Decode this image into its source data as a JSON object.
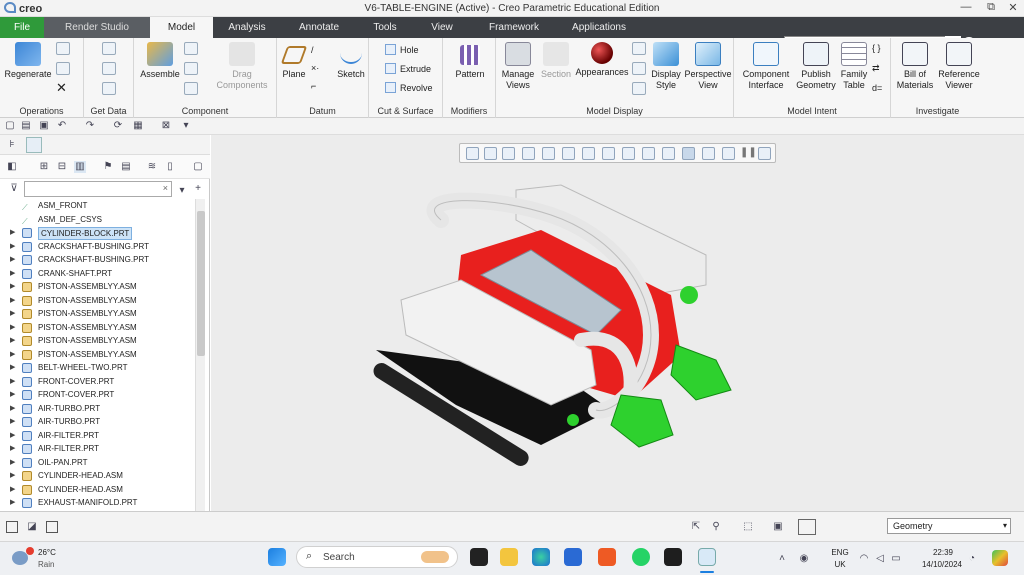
{
  "window": {
    "logo": "creo",
    "title": "V6-TABLE-ENGINE (Active) - Creo Parametric Educational Edition",
    "controls": [
      "—",
      "⧉",
      "✕"
    ]
  },
  "tabs": [
    "File",
    "Render Studio",
    "Model",
    "Analysis",
    "Annotate",
    "Tools",
    "View",
    "Framework",
    "Applications"
  ],
  "active_tab": "Model",
  "ribbon": {
    "operations": {
      "label": "Operations",
      "regenerate": "Regenerate"
    },
    "getdata": {
      "label": "Get Data"
    },
    "component": {
      "label": "Component",
      "assemble": "Assemble",
      "drag1": "Drag",
      "drag2": "Components"
    },
    "datum": {
      "label": "Datum",
      "plane": "Plane",
      "sketch": "Sketch"
    },
    "cutsurface": {
      "label": "Cut & Surface",
      "hole": "Hole",
      "extrude": "Extrude",
      "revolve": "Revolve"
    },
    "modifiers": {
      "label": "Modifiers",
      "pattern": "Pattern"
    },
    "modeldisplay": {
      "label": "Model Display",
      "manage1": "Manage",
      "manage2": "Views",
      "section": "Section",
      "appearances": "Appearances",
      "display1": "Display",
      "display2": "Style",
      "persp1": "Perspective",
      "persp2": "View"
    },
    "modelintent": {
      "label": "Model Intent",
      "ci1": "Component",
      "ci2": "Interface",
      "pg1": "Publish",
      "pg2": "Geometry",
      "ft1": "Family",
      "ft2": "Table"
    },
    "investigate": {
      "label": "Investigate",
      "bom1": "Bill of",
      "bom2": "Materials",
      "rv1": "Reference",
      "rv2": "Viewer"
    }
  },
  "model_tree": {
    "filter_placeholder": "",
    "items": [
      {
        "label": "ASM_FRONT",
        "kind": "datum"
      },
      {
        "label": "ASM_DEF_CSYS",
        "kind": "datum"
      },
      {
        "label": "CYLINDER-BLOCK.PRT",
        "kind": "part",
        "selected": true
      },
      {
        "label": "CRACKSHAFT-BUSHING.PRT",
        "kind": "part"
      },
      {
        "label": "CRACKSHAFT-BUSHING.PRT",
        "kind": "part"
      },
      {
        "label": "CRANK-SHAFT.PRT",
        "kind": "part"
      },
      {
        "label": "PISTON-ASSEMBLYY.ASM",
        "kind": "asm"
      },
      {
        "label": "PISTON-ASSEMBLYY.ASM",
        "kind": "asm"
      },
      {
        "label": "PISTON-ASSEMBLYY.ASM",
        "kind": "asm"
      },
      {
        "label": "PISTON-ASSEMBLYY.ASM",
        "kind": "asm"
      },
      {
        "label": "PISTON-ASSEMBLYY.ASM",
        "kind": "asm"
      },
      {
        "label": "PISTON-ASSEMBLYY.ASM",
        "kind": "asm"
      },
      {
        "label": "BELT-WHEEL-TWO.PRT",
        "kind": "part"
      },
      {
        "label": "FRONT-COVER.PRT",
        "kind": "part"
      },
      {
        "label": "FRONT-COVER.PRT",
        "kind": "part"
      },
      {
        "label": "AIR-TURBO.PRT",
        "kind": "part"
      },
      {
        "label": "AIR-TURBO.PRT",
        "kind": "part"
      },
      {
        "label": "AIR-FILTER.PRT",
        "kind": "part"
      },
      {
        "label": "AIR-FILTER.PRT",
        "kind": "part"
      },
      {
        "label": "OIL-PAN.PRT",
        "kind": "part"
      },
      {
        "label": "CYLINDER-HEAD.ASM",
        "kind": "asm"
      },
      {
        "label": "CYLINDER-HEAD.ASM",
        "kind": "asm"
      },
      {
        "label": "EXHAUST-MANIFOLD.PRT",
        "kind": "part"
      }
    ]
  },
  "statusbar": {
    "filter_value": "Geometry"
  },
  "taskbar": {
    "weather_temp": "26°C",
    "weather_desc": "Rain",
    "search_label": "Search",
    "lang1": "ENG",
    "lang2": "UK",
    "time": "22:39",
    "date": "14/10/2024"
  },
  "colors": {
    "file_tab": "#2f9a3a",
    "tabbar": "#3c3f44",
    "viewport": "#ececec",
    "engine_red": "#e8201e",
    "engine_green": "#2ed12e",
    "engine_white": "#f2f2f2"
  }
}
